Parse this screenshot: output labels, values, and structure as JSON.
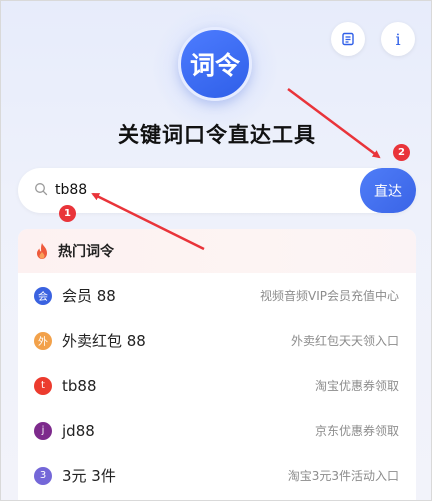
{
  "header": {
    "logo_text": "词令",
    "title": "关键词口令直达工具",
    "doc_icon": "document-icon",
    "info_label": "i"
  },
  "search": {
    "value": "tb88",
    "icon": "search-icon",
    "go_label": "直达"
  },
  "hot": {
    "label": "热门词令",
    "icon": "fire-icon",
    "items": [
      {
        "badge": "会",
        "name": "会员 88",
        "desc": "视频音频VIP会员充值中心",
        "color": "#3a62e0"
      },
      {
        "badge": "外",
        "name": "外卖红包 88",
        "desc": "外卖红包天天领入口",
        "color": "#f2a14a"
      },
      {
        "badge": "t",
        "name": "tb88",
        "desc": "淘宝优惠券领取",
        "color": "#ec3b2e"
      },
      {
        "badge": "j",
        "name": "jd88",
        "desc": "京东优惠券领取",
        "color": "#7d2a8c"
      },
      {
        "badge": "3",
        "name": "3元 3件",
        "desc": "淘宝3元3件活动入口",
        "color": "#7467d8"
      }
    ]
  },
  "annotations": {
    "marker_1": "1",
    "marker_2": "2",
    "color": "#e9343a"
  }
}
